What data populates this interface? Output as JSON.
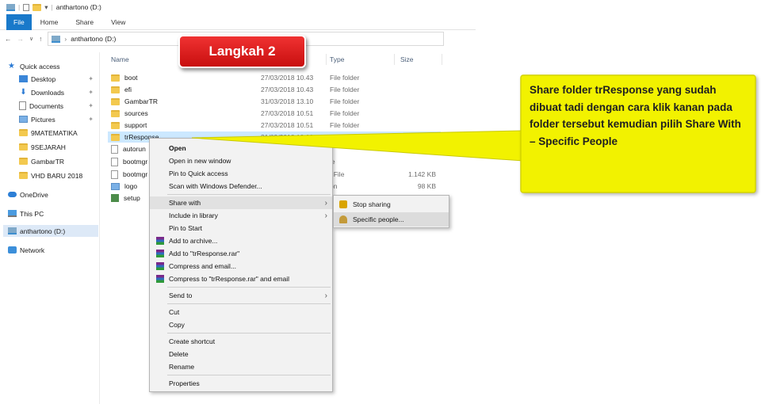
{
  "window": {
    "title": "anthartono (D:)"
  },
  "ribbon": {
    "tabs": [
      "File",
      "Home",
      "Share",
      "View"
    ]
  },
  "address": {
    "path_root": "anthartono (D:)"
  },
  "nav": {
    "quick_access": "Quick access",
    "items": [
      {
        "label": "Desktop",
        "icon": "desktop-icon",
        "pinned": true
      },
      {
        "label": "Downloads",
        "icon": "download-icon",
        "pinned": true
      },
      {
        "label": "Documents",
        "icon": "document-icon",
        "pinned": true
      },
      {
        "label": "Pictures",
        "icon": "pictures-icon",
        "pinned": true
      },
      {
        "label": "9MATEMATIKA",
        "icon": "folder-icon"
      },
      {
        "label": "9SEJARAH",
        "icon": "folder-icon"
      },
      {
        "label": "GambarTR",
        "icon": "folder-icon"
      },
      {
        "label": "VHD BARU 2018",
        "icon": "folder-icon"
      }
    ],
    "onedrive": "OneDrive",
    "thispc": "This PC",
    "drive": "anthartono (D:)",
    "network": "Network"
  },
  "columns": {
    "name": "Name",
    "type": "Type",
    "size": "Size"
  },
  "files": [
    {
      "name": "boot",
      "date": "27/03/2018 10.43",
      "type": "File folder",
      "size": ""
    },
    {
      "name": "efi",
      "date": "27/03/2018 10.43",
      "type": "File folder",
      "size": ""
    },
    {
      "name": "GambarTR",
      "date": "31/03/2018 13.10",
      "type": "File folder",
      "size": ""
    },
    {
      "name": "sources",
      "date": "27/03/2018 10.51",
      "type": "File folder",
      "size": ""
    },
    {
      "name": "support",
      "date": "27/03/2018 10.51",
      "type": "File folder",
      "size": ""
    },
    {
      "name": "trResponse",
      "date": "31/03/2018 13.08",
      "type": "File folder",
      "size": ""
    },
    {
      "name": "autorun",
      "date": "",
      "type": "",
      "size": ""
    },
    {
      "name": "bootmgr",
      "date": "",
      "type": "le",
      "size": ""
    },
    {
      "name": "bootmgr",
      "date": "",
      "type": "I File",
      "size": "1.142 KB"
    },
    {
      "name": "logo",
      "date": "",
      "type": "on",
      "size": "98 KB"
    },
    {
      "name": "setup",
      "date": "",
      "type": "",
      "size": ""
    }
  ],
  "context_menu": {
    "open": "Open",
    "open_new_window": "Open in new window",
    "pin_quick_access": "Pin to Quick access",
    "scan_defender": "Scan with Windows Defender...",
    "share_with": "Share with",
    "include_library": "Include in library",
    "pin_start": "Pin to Start",
    "add_archive": "Add to archive...",
    "add_rar": "Add to \"trResponse.rar\"",
    "compress_email": "Compress and email...",
    "compress_rar_email": "Compress to \"trResponse.rar\" and email",
    "send_to": "Send to",
    "cut": "Cut",
    "copy": "Copy",
    "create_shortcut": "Create shortcut",
    "delete": "Delete",
    "rename": "Rename",
    "properties": "Properties"
  },
  "submenu": {
    "stop_sharing": "Stop sharing",
    "specific_people": "Specific people..."
  },
  "badge": {
    "label": "Langkah 2"
  },
  "callout": {
    "text": "Share folder trResponse yang sudah dibuat tadi dengan cara klik kanan pada folder tersebut kemudian pilih Share With – Specific People"
  },
  "colors": {
    "accent": "#1979ca",
    "badge": "#e01e1e",
    "callout": "#f2f200",
    "selection": "#cce8ff"
  }
}
